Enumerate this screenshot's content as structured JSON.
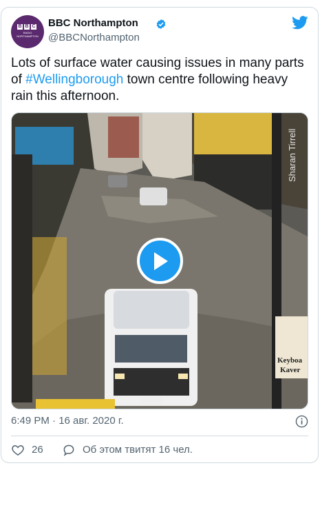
{
  "account": {
    "name": "BBC Northampton",
    "handle": "@BBCNorthampton",
    "avatar_letters": [
      "B",
      "B",
      "C"
    ],
    "avatar_subtitle": [
      "RADIO",
      "NORTHAMPTON"
    ],
    "verified": true
  },
  "tweet": {
    "text_before": "Lots of surface water causing issues in many parts of ",
    "hashtag": "#Wellingborough",
    "text_after": " town centre following heavy rain this afternoon."
  },
  "media": {
    "type": "video",
    "watermark": "Sharan Tirrell",
    "shop_sign": [
      "Keyboa",
      "Kaver"
    ]
  },
  "meta": {
    "timestamp": "6:49 PM · 16 авг. 2020 г."
  },
  "actions": {
    "like_count": "26",
    "retweet_label": "Об этом твитят 16 чел."
  },
  "colors": {
    "accent": "#1d9bf0",
    "text": "#0f1419",
    "secondary": "#536471",
    "border": "#cfd9de",
    "avatar_bg": "#5b2a6e"
  },
  "icons": [
    "verified-badge-icon",
    "twitter-bird-icon",
    "play-icon",
    "info-icon",
    "heart-icon",
    "comment-icon"
  ]
}
